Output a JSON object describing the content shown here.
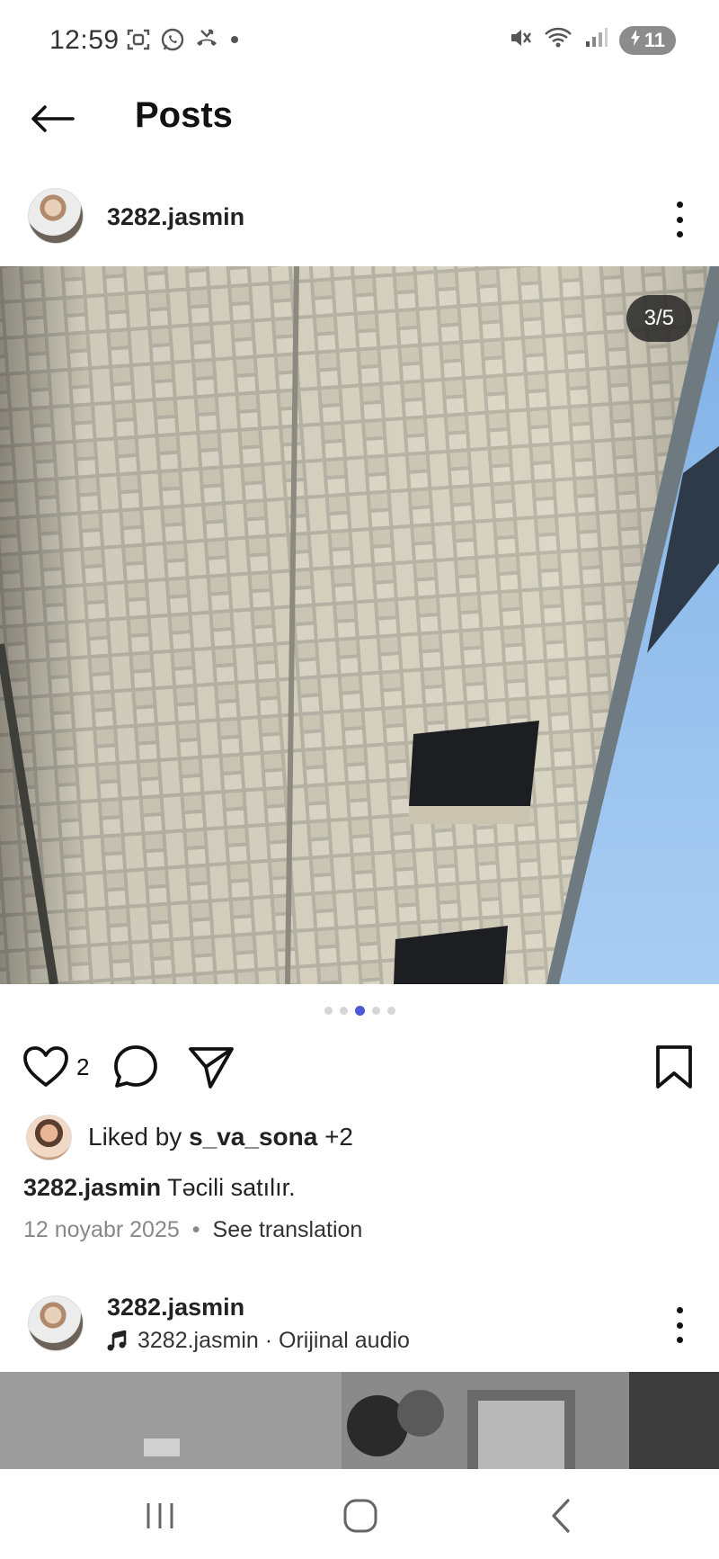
{
  "status_bar": {
    "time": "12:59",
    "battery": "11",
    "left_icons": [
      "screenshot-icon",
      "whatsapp-icon",
      "missed-call-icon",
      "dot-icon"
    ],
    "right_icons": [
      "mute-icon",
      "wifi-icon",
      "signal-icon",
      "battery-icon"
    ]
  },
  "header": {
    "title": "Posts",
    "back_icon": "arrow-left-icon"
  },
  "post": {
    "username": "3282.jasmin",
    "image_counter": "3/5",
    "carousel": {
      "count": 5,
      "active_index": 2,
      "active_color": "#4b5bd6"
    },
    "like_count": "2",
    "liked_by": {
      "prefix": "Liked by ",
      "user": "s_va_sona",
      "suffix": " +2"
    },
    "caption": {
      "username": "3282.jasmin",
      "text": " Təcili satılır."
    },
    "date": "12 noyabr 2025",
    "separator": "•",
    "translate": "See translation"
  },
  "next_post": {
    "username": "3282.jasmin",
    "audio": "3282.jasmin · Orijinal audio"
  },
  "colors": {
    "accent": "#4b5bd6",
    "text_primary": "#111111",
    "text_secondary": "#888888",
    "sky": "#9dc2ea"
  },
  "nav": {
    "icons": [
      "recent-apps-icon",
      "home-icon",
      "back-icon"
    ]
  }
}
